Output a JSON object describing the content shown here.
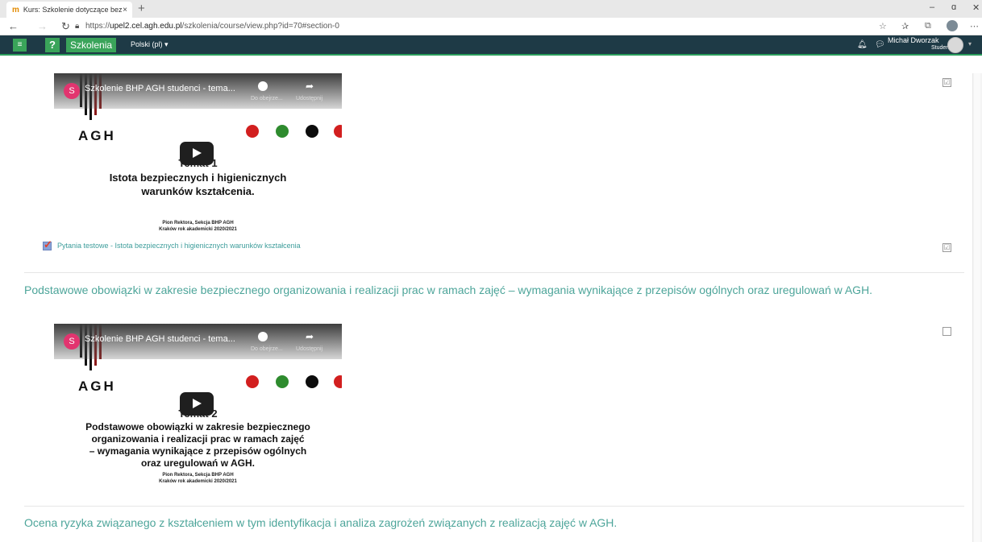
{
  "browser": {
    "tab_title": "Kurs: Szkolenie dotyczące bezpie",
    "tab_close": "×",
    "new_tab": "+",
    "url_prefix": "https://",
    "url_host": "upel2.cel.agh.edu.pl",
    "url_path": "/szkolenia/course/view.php?id=70#section-0",
    "window_min": "–",
    "window_max": "ɑ",
    "window_close": "✕",
    "more": "⋯"
  },
  "navbar": {
    "menu_glyph": "≡",
    "help_glyph": "?",
    "brand": "Szkolenia",
    "language": "Polski (pl)",
    "user_name": "Michał Dworzak",
    "user_role": "Student"
  },
  "activities": [
    {
      "video_title": "Szkolenie BHP AGH studenci - tema...",
      "avatar_letter": "S",
      "watch_later_label": "Do obejrze...",
      "share_label": "Udostępnij",
      "logo_text": "AGH",
      "slide_kicker": "Temat 1",
      "slide_title_lines": [
        "Istota bezpiecznych i higienicznych",
        "warunków kształcenia."
      ],
      "slide_footer_lines": [
        "Pion Rektora, Sekcja BHP AGH",
        "Kraków rok akademicki 2020/2021"
      ],
      "completion_glyph": "☑"
    },
    {
      "video_title": "Szkolenie BHP AGH studenci - tema...",
      "avatar_letter": "S",
      "watch_later_label": "Do obejrze...",
      "share_label": "Udostępnij",
      "logo_text": "AGH",
      "slide_kicker": "Temat 2",
      "slide_title_lines": [
        "Podstawowe obowiązki w zakresie bezpiecznego",
        "organizowania i realizacji prac w ramach zajęć",
        "– wymagania wynikające z przepisów ogólnych",
        "oraz uregulowań w AGH."
      ],
      "slide_footer_lines": [
        "Pion Rektora, Sekcja BHP AGH",
        "Kraków rok akademicki 2020/2021"
      ],
      "completion_glyph": ""
    }
  ],
  "quiz": {
    "label": "Pytania testowe - Istota bezpiecznych i higienicznych warunków kształcenia",
    "completion_glyph": "☑"
  },
  "sections": [
    {
      "title": "Podstawowe obowiązki w zakresie bezpiecznego organizowania i realizacji prac w ramach zajęć – wymagania wynikające z przepisów ogólnych oraz uregulowań w AGH."
    },
    {
      "title": "Ocena ryzyka związanego z kształceniem w tym identyfikacja i analiza zagrożeń związanych z realizacją zajęć w AGH."
    }
  ],
  "colors": {
    "navbar_bg": "#1e3a46",
    "brand_green": "#3aa45a",
    "section_title": "#4da59a",
    "link": "#3d9d9b"
  }
}
